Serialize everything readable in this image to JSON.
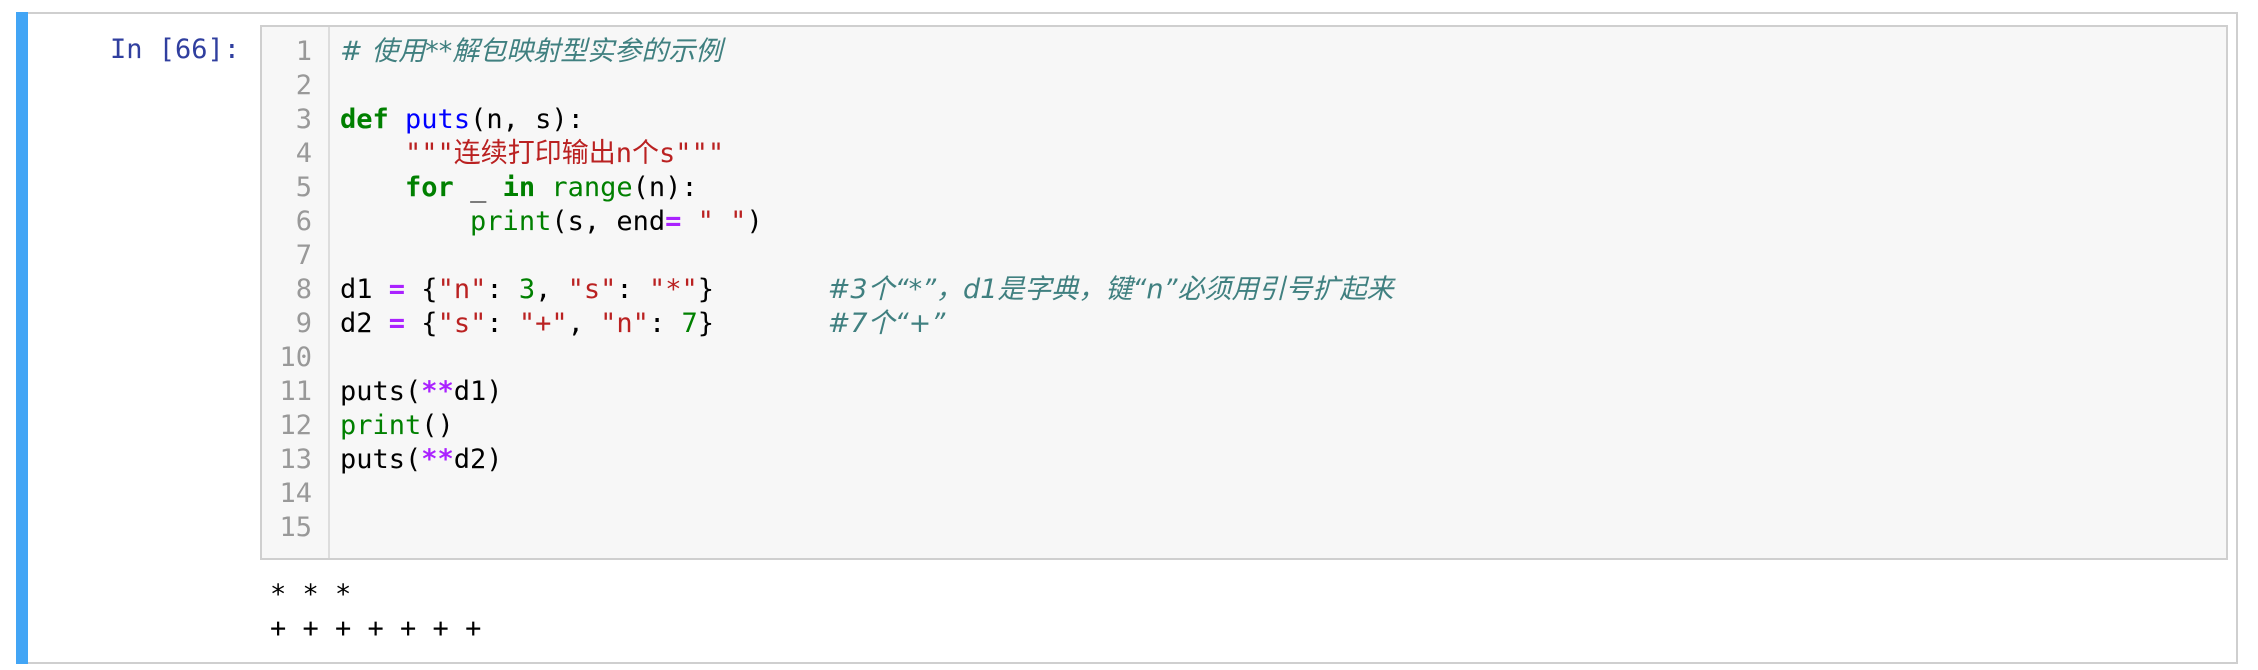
{
  "cell": {
    "prompt": "In [66]:",
    "line_numbers": [
      "1",
      "2",
      "3",
      "4",
      "5",
      "6",
      "7",
      "8",
      "9",
      "10",
      "11",
      "12",
      "13",
      "14",
      "15"
    ],
    "code": {
      "l1_comment": "# 使用**解包映射型实参的示例",
      "l3_def": "def",
      "l3_name": "puts",
      "l3_rest": "(n, s):",
      "l4_indent": "    ",
      "l4_doc": "\"\"\"连续打印输出n个s\"\"\"",
      "l5_indent": "    ",
      "l5_for": "for",
      "l5_mid": " _ ",
      "l5_in": "in",
      "l5_sp": " ",
      "l5_range": "range",
      "l5_rest": "(n):",
      "l6_indent": "        ",
      "l6_print": "print",
      "l6_a": "(s, end",
      "l6_eq": "=",
      "l6_sp": " ",
      "l6_str": "\" \"",
      "l6_close": ")",
      "l8_var": "d1 ",
      "l8_eq": "=",
      "l8_open": " {",
      "l8_k1": "\"n\"",
      "l8_c1": ": ",
      "l8_v1": "3",
      "l8_sep": ", ",
      "l8_k2": "\"s\"",
      "l8_c2": ": ",
      "l8_v2": "\"*\"",
      "l8_close": "}",
      "l8_pad": "       ",
      "l8_comment": "#3个“*”，d1是字典，键“n”必须用引号扩起来",
      "l9_var": "d2 ",
      "l9_eq": "=",
      "l9_open": " {",
      "l9_k1": "\"s\"",
      "l9_c1": ": ",
      "l9_v1": "\"+\"",
      "l9_sep": ", ",
      "l9_k2": "\"n\"",
      "l9_c2": ": ",
      "l9_v2": "7",
      "l9_close": "}",
      "l9_pad": "       ",
      "l9_comment": "#7个“+”",
      "l11_fn": "puts(",
      "l11_op": "**",
      "l11_rest": "d1)",
      "l12_print": "print",
      "l12_rest": "()",
      "l13_fn": "puts(",
      "l13_op": "**",
      "l13_rest": "d2)"
    },
    "output": [
      "* * *",
      "+ + + + + + +"
    ]
  }
}
